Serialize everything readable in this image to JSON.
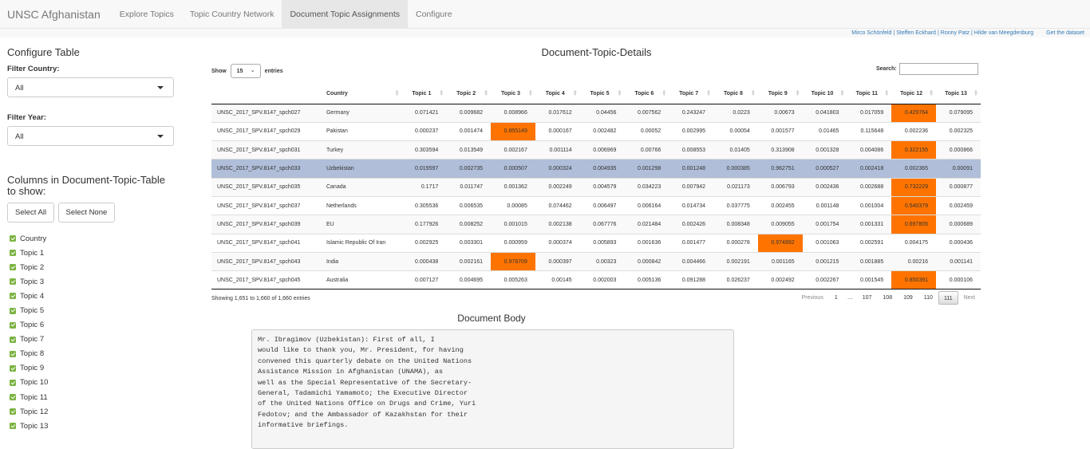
{
  "navbar": {
    "brand": "UNSC Afghanistan",
    "items": [
      {
        "label": "Explore Topics",
        "active": false
      },
      {
        "label": "Topic Country Network",
        "active": false
      },
      {
        "label": "Document Topic Assignments",
        "active": true
      },
      {
        "label": "Configure",
        "active": false
      }
    ]
  },
  "credits": {
    "authors": [
      "Mirco Schönfeld",
      "Steffen Eckhard",
      "Ronny Patz",
      "Hilde van Meegdenburg"
    ],
    "separator": "|",
    "dataset_link": "Get the dataset"
  },
  "sidebar": {
    "title": "Configure Table",
    "filter_country": {
      "label": "Filter Country:",
      "value": "All"
    },
    "filter_year": {
      "label": "Filter Year:",
      "value": "All"
    },
    "columns_title": "Columns in Document-Topic-Table to show:",
    "select_all": "Select All",
    "select_none": "Select None",
    "columns": [
      {
        "label": "Country",
        "checked": true
      },
      {
        "label": "Topic 1",
        "checked": true
      },
      {
        "label": "Topic 2",
        "checked": true
      },
      {
        "label": "Topic 3",
        "checked": true
      },
      {
        "label": "Topic 4",
        "checked": true
      },
      {
        "label": "Topic 5",
        "checked": true
      },
      {
        "label": "Topic 6",
        "checked": true
      },
      {
        "label": "Topic 7",
        "checked": true
      },
      {
        "label": "Topic 8",
        "checked": true
      },
      {
        "label": "Topic 9",
        "checked": true
      },
      {
        "label": "Topic 10",
        "checked": true
      },
      {
        "label": "Topic 11",
        "checked": true
      },
      {
        "label": "Topic 12",
        "checked": true
      },
      {
        "label": "Topic 13",
        "checked": true
      }
    ]
  },
  "main": {
    "title": "Document-Topic-Details",
    "show_label": "Show",
    "page_length": "15",
    "entries_label": "entries",
    "search_label": "Search:",
    "search_value": "",
    "highlight_color": "#ff7400",
    "selected_row_color": "#b0bed9",
    "table": {
      "headers": [
        "",
        "Country",
        "Topic 1",
        "Topic 2",
        "Topic 3",
        "Topic 4",
        "Topic 5",
        "Topic 6",
        "Topic 7",
        "Topic 8",
        "Topic 9",
        "Topic 10",
        "Topic 11",
        "Topic 12",
        "Topic 13"
      ],
      "rows": [
        {
          "id": "UNSC_2017_SPV.8147_spch027",
          "country": "Germany",
          "values": [
            "0.071421",
            "0.009682",
            "0.008966",
            "0.017612",
            "0.04456",
            "0.007562",
            "0.243247",
            "0.0223",
            "0.00673",
            "0.041803",
            "0.017059",
            "0.429764",
            "0.079095"
          ],
          "highlight": [
            11
          ],
          "selected": false
        },
        {
          "id": "UNSC_2017_SPV.8147_spch029",
          "country": "Pakistan",
          "values": [
            "0.000237",
            "0.001474",
            "0.855149",
            "0.000167",
            "0.002482",
            "0.00052",
            "0.002995",
            "0.00054",
            "0.001577",
            "0.01465",
            "0.115648",
            "0.002236",
            "0.002325"
          ],
          "highlight": [
            2
          ],
          "selected": false
        },
        {
          "id": "UNSC_2017_SPV.8147_spch031",
          "country": "Turkey",
          "values": [
            "0.303594",
            "0.013549",
            "0.002167",
            "0.001114",
            "0.006969",
            "0.00766",
            "0.008553",
            "0.01405",
            "0.313908",
            "0.001328",
            "0.004086",
            "0.322155",
            "0.000866"
          ],
          "highlight": [
            11
          ],
          "selected": false
        },
        {
          "id": "UNSC_2017_SPV.8147_spch033",
          "country": "Uzbekistan",
          "values": [
            "0.019597",
            "0.002735",
            "0.000507",
            "0.000324",
            "0.004935",
            "0.001298",
            "0.001248",
            "0.000385",
            "0.962751",
            "0.000527",
            "0.002418",
            "0.002365",
            "0.00091"
          ],
          "highlight": [],
          "selected": true
        },
        {
          "id": "UNSC_2017_SPV.8147_spch035",
          "country": "Canada",
          "values": [
            "0.1717",
            "0.011747",
            "0.001362",
            "0.002249",
            "0.004579",
            "0.034223",
            "0.007942",
            "0.021173",
            "0.006793",
            "0.002436",
            "0.002688",
            "0.732229",
            "0.000877"
          ],
          "highlight": [
            11
          ],
          "selected": false
        },
        {
          "id": "UNSC_2017_SPV.8147_spch037",
          "country": "Netherlands",
          "values": [
            "0.305536",
            "0.006535",
            "0.00085",
            "0.074462",
            "0.006497",
            "0.006164",
            "0.014734",
            "0.037775",
            "0.002455",
            "0.001148",
            "0.001004",
            "0.540379",
            "0.002459"
          ],
          "highlight": [
            11
          ],
          "selected": false
        },
        {
          "id": "UNSC_2017_SPV.8147_spch039",
          "country": "EU",
          "values": [
            "0.177926",
            "0.008252",
            "0.001015",
            "0.002138",
            "0.067776",
            "0.021484",
            "0.002426",
            "0.008348",
            "0.009055",
            "0.001754",
            "0.001331",
            "0.697805",
            "0.000689"
          ],
          "highlight": [
            11
          ],
          "selected": false
        },
        {
          "id": "UNSC_2017_SPV.8147_spch041",
          "country": "Islamic Republic Of Iran",
          "values": [
            "0.002925",
            "0.003301",
            "0.000959",
            "0.000374",
            "0.005893",
            "0.001636",
            "0.001477",
            "0.000278",
            "0.974892",
            "0.001063",
            "0.002591",
            "0.004175",
            "0.000436"
          ],
          "highlight": [
            8
          ],
          "selected": false
        },
        {
          "id": "UNSC_2017_SPV.8147_spch043",
          "country": "India",
          "values": [
            "0.000438",
            "0.002161",
            "0.978709",
            "0.000397",
            "0.00323",
            "0.000842",
            "0.004466",
            "0.002191",
            "0.001165",
            "0.001215",
            "0.001885",
            "0.00216",
            "0.001141"
          ],
          "highlight": [
            2
          ],
          "selected": false
        },
        {
          "id": "UNSC_2017_SPV.8147_spch045",
          "country": "Australia",
          "values": [
            "0.007127",
            "0.004695",
            "0.005263",
            "0.00145",
            "0.002003",
            "0.005136",
            "0.091288",
            "0.026237",
            "0.002492",
            "0.002267",
            "0.001545",
            "0.850391",
            "0.000106"
          ],
          "highlight": [
            11
          ],
          "selected": false
        }
      ]
    },
    "info": "Showing 1,651 to 1,660 of 1,660 entries",
    "pagination": {
      "previous": "Previous",
      "pages": [
        "1",
        "…",
        "107",
        "108",
        "109",
        "110",
        "111"
      ],
      "current": "111",
      "next": "Next"
    }
  },
  "document": {
    "title": "Document Body",
    "text": "Mr. Ibragimov (Uzbekistan): First of all, I\nwould like to thank you, Mr. President, for having\nconvened this quarterly debate on the United Nations\nAssistance Mission in Afghanistan (UNAMA), as\nwell as the Special Representative of the Secretary-\nGeneral, Tadamichi Yamamoto; the Executive Director\nof the United Nations Office on Drugs and Crime, Yuri\nFedotov; and the Ambassador of Kazakhstan for their\ninformative briefings."
  }
}
